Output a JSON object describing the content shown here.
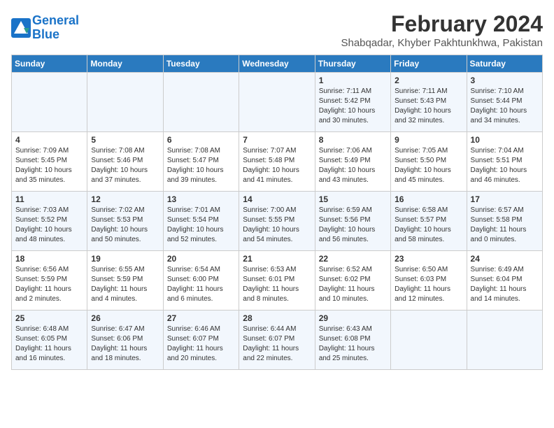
{
  "header": {
    "logo_line1": "General",
    "logo_line2": "Blue",
    "month_year": "February 2024",
    "location": "Shabqadar, Khyber Pakhtunkhwa, Pakistan"
  },
  "weekdays": [
    "Sunday",
    "Monday",
    "Tuesday",
    "Wednesday",
    "Thursday",
    "Friday",
    "Saturday"
  ],
  "weeks": [
    [
      {
        "day": "",
        "sunrise": "",
        "sunset": "",
        "daylight": ""
      },
      {
        "day": "",
        "sunrise": "",
        "sunset": "",
        "daylight": ""
      },
      {
        "day": "",
        "sunrise": "",
        "sunset": "",
        "daylight": ""
      },
      {
        "day": "",
        "sunrise": "",
        "sunset": "",
        "daylight": ""
      },
      {
        "day": "1",
        "sunrise": "Sunrise: 7:11 AM",
        "sunset": "Sunset: 5:42 PM",
        "daylight": "Daylight: 10 hours and 30 minutes."
      },
      {
        "day": "2",
        "sunrise": "Sunrise: 7:11 AM",
        "sunset": "Sunset: 5:43 PM",
        "daylight": "Daylight: 10 hours and 32 minutes."
      },
      {
        "day": "3",
        "sunrise": "Sunrise: 7:10 AM",
        "sunset": "Sunset: 5:44 PM",
        "daylight": "Daylight: 10 hours and 34 minutes."
      }
    ],
    [
      {
        "day": "4",
        "sunrise": "Sunrise: 7:09 AM",
        "sunset": "Sunset: 5:45 PM",
        "daylight": "Daylight: 10 hours and 35 minutes."
      },
      {
        "day": "5",
        "sunrise": "Sunrise: 7:08 AM",
        "sunset": "Sunset: 5:46 PM",
        "daylight": "Daylight: 10 hours and 37 minutes."
      },
      {
        "day": "6",
        "sunrise": "Sunrise: 7:08 AM",
        "sunset": "Sunset: 5:47 PM",
        "daylight": "Daylight: 10 hours and 39 minutes."
      },
      {
        "day": "7",
        "sunrise": "Sunrise: 7:07 AM",
        "sunset": "Sunset: 5:48 PM",
        "daylight": "Daylight: 10 hours and 41 minutes."
      },
      {
        "day": "8",
        "sunrise": "Sunrise: 7:06 AM",
        "sunset": "Sunset: 5:49 PM",
        "daylight": "Daylight: 10 hours and 43 minutes."
      },
      {
        "day": "9",
        "sunrise": "Sunrise: 7:05 AM",
        "sunset": "Sunset: 5:50 PM",
        "daylight": "Daylight: 10 hours and 45 minutes."
      },
      {
        "day": "10",
        "sunrise": "Sunrise: 7:04 AM",
        "sunset": "Sunset: 5:51 PM",
        "daylight": "Daylight: 10 hours and 46 minutes."
      }
    ],
    [
      {
        "day": "11",
        "sunrise": "Sunrise: 7:03 AM",
        "sunset": "Sunset: 5:52 PM",
        "daylight": "Daylight: 10 hours and 48 minutes."
      },
      {
        "day": "12",
        "sunrise": "Sunrise: 7:02 AM",
        "sunset": "Sunset: 5:53 PM",
        "daylight": "Daylight: 10 hours and 50 minutes."
      },
      {
        "day": "13",
        "sunrise": "Sunrise: 7:01 AM",
        "sunset": "Sunset: 5:54 PM",
        "daylight": "Daylight: 10 hours and 52 minutes."
      },
      {
        "day": "14",
        "sunrise": "Sunrise: 7:00 AM",
        "sunset": "Sunset: 5:55 PM",
        "daylight": "Daylight: 10 hours and 54 minutes."
      },
      {
        "day": "15",
        "sunrise": "Sunrise: 6:59 AM",
        "sunset": "Sunset: 5:56 PM",
        "daylight": "Daylight: 10 hours and 56 minutes."
      },
      {
        "day": "16",
        "sunrise": "Sunrise: 6:58 AM",
        "sunset": "Sunset: 5:57 PM",
        "daylight": "Daylight: 10 hours and 58 minutes."
      },
      {
        "day": "17",
        "sunrise": "Sunrise: 6:57 AM",
        "sunset": "Sunset: 5:58 PM",
        "daylight": "Daylight: 11 hours and 0 minutes."
      }
    ],
    [
      {
        "day": "18",
        "sunrise": "Sunrise: 6:56 AM",
        "sunset": "Sunset: 5:59 PM",
        "daylight": "Daylight: 11 hours and 2 minutes."
      },
      {
        "day": "19",
        "sunrise": "Sunrise: 6:55 AM",
        "sunset": "Sunset: 5:59 PM",
        "daylight": "Daylight: 11 hours and 4 minutes."
      },
      {
        "day": "20",
        "sunrise": "Sunrise: 6:54 AM",
        "sunset": "Sunset: 6:00 PM",
        "daylight": "Daylight: 11 hours and 6 minutes."
      },
      {
        "day": "21",
        "sunrise": "Sunrise: 6:53 AM",
        "sunset": "Sunset: 6:01 PM",
        "daylight": "Daylight: 11 hours and 8 minutes."
      },
      {
        "day": "22",
        "sunrise": "Sunrise: 6:52 AM",
        "sunset": "Sunset: 6:02 PM",
        "daylight": "Daylight: 11 hours and 10 minutes."
      },
      {
        "day": "23",
        "sunrise": "Sunrise: 6:50 AM",
        "sunset": "Sunset: 6:03 PM",
        "daylight": "Daylight: 11 hours and 12 minutes."
      },
      {
        "day": "24",
        "sunrise": "Sunrise: 6:49 AM",
        "sunset": "Sunset: 6:04 PM",
        "daylight": "Daylight: 11 hours and 14 minutes."
      }
    ],
    [
      {
        "day": "25",
        "sunrise": "Sunrise: 6:48 AM",
        "sunset": "Sunset: 6:05 PM",
        "daylight": "Daylight: 11 hours and 16 minutes."
      },
      {
        "day": "26",
        "sunrise": "Sunrise: 6:47 AM",
        "sunset": "Sunset: 6:06 PM",
        "daylight": "Daylight: 11 hours and 18 minutes."
      },
      {
        "day": "27",
        "sunrise": "Sunrise: 6:46 AM",
        "sunset": "Sunset: 6:07 PM",
        "daylight": "Daylight: 11 hours and 20 minutes."
      },
      {
        "day": "28",
        "sunrise": "Sunrise: 6:44 AM",
        "sunset": "Sunset: 6:07 PM",
        "daylight": "Daylight: 11 hours and 22 minutes."
      },
      {
        "day": "29",
        "sunrise": "Sunrise: 6:43 AM",
        "sunset": "Sunset: 6:08 PM",
        "daylight": "Daylight: 11 hours and 25 minutes."
      },
      {
        "day": "",
        "sunrise": "",
        "sunset": "",
        "daylight": ""
      },
      {
        "day": "",
        "sunrise": "",
        "sunset": "",
        "daylight": ""
      }
    ]
  ]
}
